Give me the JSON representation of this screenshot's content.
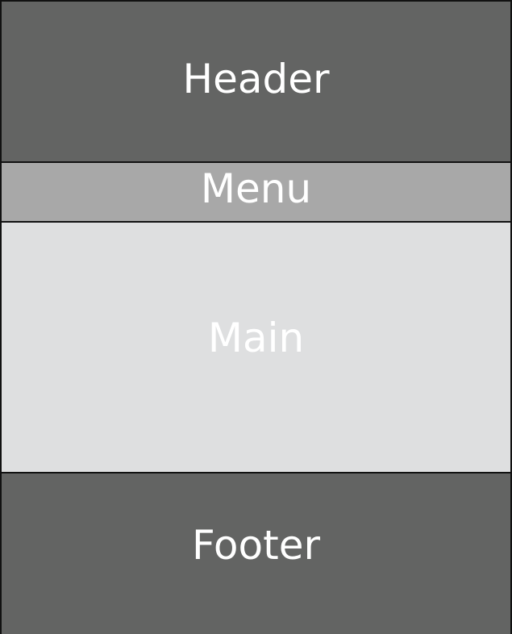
{
  "layout": {
    "header": "Header",
    "menu": "Menu",
    "main": "Main",
    "footer": "Footer"
  }
}
